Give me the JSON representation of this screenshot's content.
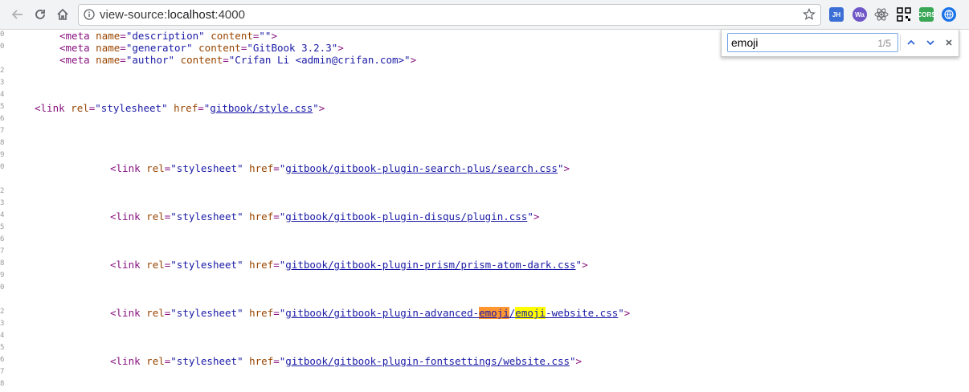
{
  "browser": {
    "address_scheme": "view-source:",
    "address_host": "localhost",
    "address_port": ":4000",
    "icons": {
      "back": "arrow-left-icon",
      "reload": "reload-icon",
      "home": "home-icon",
      "info": "info-icon",
      "bookmark": "star-icon"
    },
    "extensions": [
      {
        "name": "JH",
        "color": "#3b6fd6"
      },
      {
        "name": "Wa",
        "color": "#6f57c7"
      },
      {
        "name": "react-devtools",
        "color": "#61dafb"
      },
      {
        "name": "qr-code",
        "color": "#000000"
      },
      {
        "name": "CORS",
        "color": "#3aa757"
      },
      {
        "name": "globe",
        "color": "#1a73e8"
      }
    ]
  },
  "find_bar": {
    "query": "emoji",
    "count": "1/5"
  },
  "gutter": [
    "0",
    "0",
    "2",
    "3",
    "4",
    "5",
    "6",
    "7",
    "8",
    "9",
    "0",
    "2",
    "3",
    "4",
    "5",
    "6",
    "7",
    "8",
    "9",
    "0",
    "2",
    "3",
    "4",
    "5",
    "6",
    "7",
    "8"
  ],
  "source": {
    "meta_description": {
      "tag_open": "<meta",
      "a1": "name",
      "v1": "\"description\"",
      "a2": "content",
      "v2": "\"\"",
      "close": ">"
    },
    "meta_generator": {
      "tag_open": "<meta",
      "a1": "name",
      "v1": "\"generator\"",
      "a2": "content",
      "v2": "\"GitBook 3.2.3\"",
      "close": ">"
    },
    "meta_author": {
      "tag_open": "<meta",
      "a1": "name",
      "v1": "\"author\"",
      "a2": "content",
      "v2": "\"Crifan Li <admin@crifan.com>\"",
      "close": ">"
    },
    "link_style": {
      "tag_open": "<link",
      "a1": "rel",
      "v1": "\"stylesheet\"",
      "a2": "href",
      "href": "gitbook/style.css",
      "close": ">"
    },
    "link_search": {
      "tag_open": "<link",
      "a1": "rel",
      "v1": "\"stylesheet\"",
      "a2": "href",
      "href": "gitbook/gitbook-plugin-search-plus/search.css",
      "close": ">"
    },
    "link_disqus": {
      "tag_open": "<link",
      "a1": "rel",
      "v1": "\"stylesheet\"",
      "a2": "href",
      "href": "gitbook/gitbook-plugin-disqus/plugin.css",
      "close": ">"
    },
    "link_prism": {
      "tag_open": "<link",
      "a1": "rel",
      "v1": "\"stylesheet\"",
      "a2": "href",
      "href": "gitbook/gitbook-plugin-prism/prism-atom-dark.css",
      "close": ">"
    },
    "link_emoji": {
      "tag_open": "<link",
      "a1": "rel",
      "v1": "\"stylesheet\"",
      "a2": "href",
      "href_pre": "gitbook/gitbook-plugin-advanced-",
      "match1": "emoji",
      "slash": "/",
      "match2": "emoji",
      "href_post": "-website.css",
      "close": ">"
    },
    "link_fontsettings": {
      "tag_open": "<link",
      "a1": "rel",
      "v1": "\"stylesheet\"",
      "a2": "href",
      "href": "gitbook/gitbook-plugin-fontsettings/website.css",
      "close": ">"
    }
  }
}
